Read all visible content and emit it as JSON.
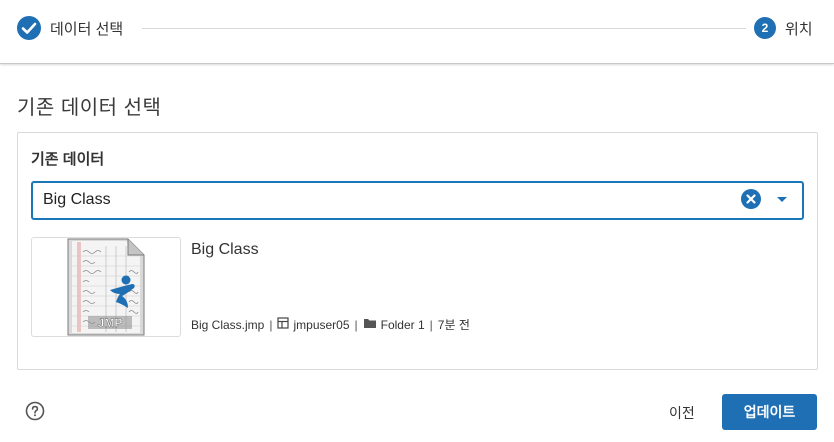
{
  "stepper": {
    "step1_label": "데이터 선택",
    "step2_number": "2",
    "step2_label": "위치"
  },
  "page_title": "기존 데이터 선택",
  "card": {
    "heading": "기존 데이터",
    "combo_value": "Big Class",
    "item": {
      "name": "Big Class",
      "filename": "Big Class.jmp",
      "owner": "jmpuser05",
      "folder": "Folder 1",
      "modified": "7분 전",
      "thumbnail_logo": "JMP"
    }
  },
  "footer": {
    "prev_label": "이전",
    "update_label": "업데이트"
  },
  "colors": {
    "accent": "#1f6fb5",
    "border": "#dadada"
  },
  "icons": [
    "check-icon",
    "clear-icon",
    "chevron-down-icon",
    "table-icon",
    "folder-icon",
    "help-icon"
  ]
}
